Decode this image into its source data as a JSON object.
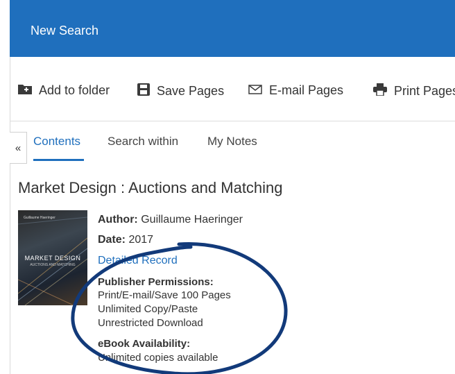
{
  "header": {
    "new_search": "New Search"
  },
  "toolbar": {
    "add_to_folder": "Add to folder",
    "save_pages": "Save Pages",
    "email_pages": "E-mail Pages",
    "print_pages": "Print Pages"
  },
  "panel": {
    "toggle": "«"
  },
  "tabs": [
    {
      "label": "Contents",
      "active": true
    },
    {
      "label": "Search within",
      "active": false
    },
    {
      "label": "My Notes",
      "active": false
    }
  ],
  "book": {
    "title": "Market Design : Auctions and Matching",
    "author_label": "Author:",
    "author": "Guillaume Haeringer",
    "date_label": "Date:",
    "date": "2017",
    "detailed_record": "Detailed Record",
    "permissions_heading": "Publisher Permissions:",
    "permissions": [
      "Print/E-mail/Save 100 Pages",
      "Unlimited Copy/Paste",
      "Unrestricted Download"
    ],
    "availability_heading": "eBook Availability:",
    "availability": "Unlimited copies available",
    "cover": {
      "author": "Guillaume Haeringer",
      "title": "MARKET DESIGN",
      "subtitle": "AUCTIONS AND MATCHING"
    }
  },
  "colors": {
    "accent": "#1f6fbd",
    "annotation": "#123a7a"
  }
}
